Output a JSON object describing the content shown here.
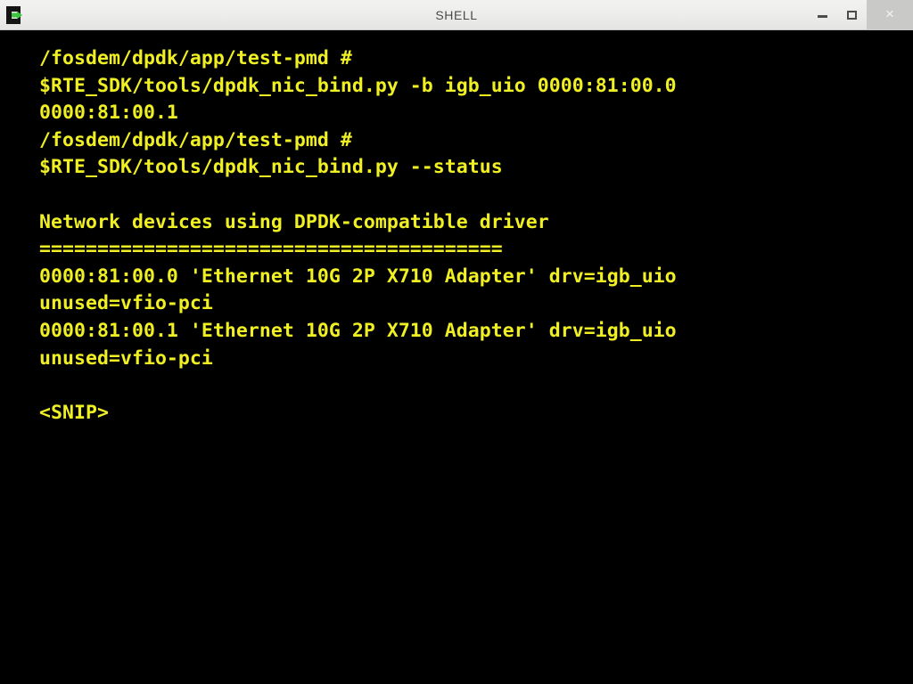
{
  "window": {
    "title": "SHELL",
    "icon": "terminal-icon",
    "controls": {
      "minimize": "–",
      "maximize": "□",
      "close": "×"
    }
  },
  "theme": {
    "titlebar_bg": "#ececea",
    "titlebar_text": "#4a4a4a",
    "close_button_bg": "#c9c9c7",
    "terminal_bg": "#000000",
    "terminal_fg": "#efef24",
    "icon_accent": "#3fc43f"
  },
  "terminal": {
    "lines": [
      "/fosdem/dpdk/app/test-pmd #",
      "$RTE_SDK/tools/dpdk_nic_bind.py -b igb_uio 0000:81:00.0",
      "0000:81:00.1",
      "/fosdem/dpdk/app/test-pmd #",
      "$RTE_SDK/tools/dpdk_nic_bind.py --status",
      "",
      "Network devices using DPDK-compatible driver",
      "========================================",
      "0000:81:00.0 'Ethernet 10G 2P X710 Adapter' drv=igb_uio",
      "unused=vfio-pci",
      "0000:81:00.1 'Ethernet 10G 2P X710 Adapter' drv=igb_uio",
      "unused=vfio-pci",
      "",
      "<SNIP>"
    ]
  }
}
